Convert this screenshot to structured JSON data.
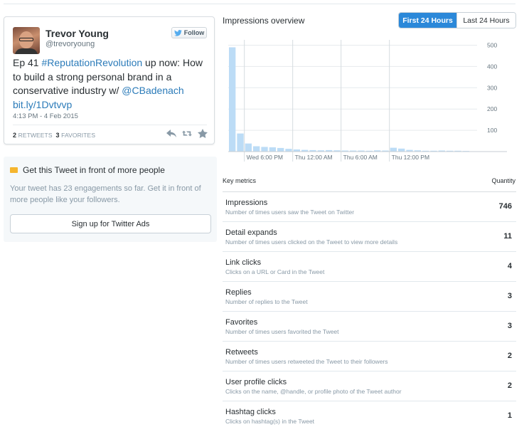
{
  "tweet": {
    "author_name": "Trevor Young",
    "author_handle": "@trevoryoung",
    "follow_label": "Follow",
    "text_before": "Ep 41 ",
    "hashtag": "#ReputationRevolution",
    "text_middle": " up now: How to build a strong personal brand in a conservative industry w/ ",
    "mention": "@CBadenach",
    "url": "bit.ly/1Dvtvvp",
    "timestamp": "4:13 PM - 4 Feb 2015",
    "retweets_count": "2",
    "retweets_label": "RETWEETS",
    "favorites_count": "3",
    "favorites_label": "FAVORITES"
  },
  "ads": {
    "title": "Get this Tweet in front of more people",
    "description": "Your tweet has 23 engagements so far. Get it in front of more people like your followers.",
    "button_label": "Sign up for Twitter Ads"
  },
  "overview": {
    "title": "Impressions overview",
    "toggle_active": "First 24 Hours",
    "toggle_inactive": "Last 24 Hours"
  },
  "chart_data": {
    "type": "bar",
    "values": [
      490,
      85,
      38,
      25,
      22,
      20,
      17,
      13,
      10,
      8,
      7,
      6,
      7,
      6,
      5,
      5,
      5,
      4,
      6,
      5,
      18,
      14,
      8,
      6,
      4,
      4,
      5,
      4,
      4,
      3
    ],
    "x_tick_labels": [
      "Wed 6:00 PM",
      "Thu 12:00 AM",
      "Thu 6:00 AM",
      "Thu 12:00 PM"
    ],
    "x_tick_positions": [
      1.5,
      7.5,
      13.5,
      19.5
    ],
    "y_ticks": [
      100,
      200,
      300,
      400,
      500
    ],
    "ylim": [
      0,
      500
    ],
    "bar_color": "#bcdcf6",
    "grid": true
  },
  "metrics": {
    "header_label": "Key metrics",
    "header_qty": "Quantity",
    "rows": [
      {
        "name": "Impressions",
        "desc": "Number of times users saw the Tweet on Twitter",
        "qty": "746"
      },
      {
        "name": "Detail expands",
        "desc": "Number of times users clicked on the Tweet to view more details",
        "qty": "11"
      },
      {
        "name": "Link clicks",
        "desc": "Clicks on a URL or Card in the Tweet",
        "qty": "4"
      },
      {
        "name": "Replies",
        "desc": "Number of replies to the Tweet",
        "qty": "3"
      },
      {
        "name": "Favorites",
        "desc": "Number of times users favorited the Tweet",
        "qty": "3"
      },
      {
        "name": "Retweets",
        "desc": "Number of times users retweeted the Tweet to their followers",
        "qty": "2"
      },
      {
        "name": "User profile clicks",
        "desc": "Clicks on the name, @handle, or profile photo of the Tweet author",
        "qty": "2"
      },
      {
        "name": "Hashtag clicks",
        "desc": "Clicks on hashtag(s) in the Tweet",
        "qty": "1"
      }
    ]
  }
}
